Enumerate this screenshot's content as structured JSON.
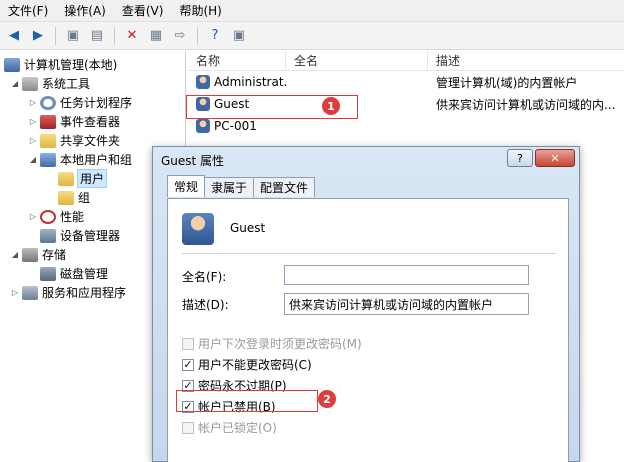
{
  "menubar": {
    "items": [
      "文件(F)",
      "操作(A)",
      "查看(V)",
      "帮助(H)"
    ]
  },
  "toolbar": {
    "buttons": [
      "back-arrow-icon",
      "forward-arrow-icon",
      "up-folder-icon",
      "show-hide-tree-icon",
      "delete-icon",
      "properties-icon",
      "export-icon",
      "help-icon",
      "panel-icon"
    ]
  },
  "tree": {
    "items": [
      {
        "label": "计算机管理(本地)",
        "icon": "computer-icon"
      },
      {
        "label": "系统工具",
        "icon": "tools-icon"
      },
      {
        "label": "任务计划程序",
        "icon": "clock-icon"
      },
      {
        "label": "事件查看器",
        "icon": "event-viewer-icon"
      },
      {
        "label": "共享文件夹",
        "icon": "shared-folder-icon"
      },
      {
        "label": "本地用户和组",
        "icon": "users-group-icon"
      },
      {
        "label": "用户",
        "icon": "folder-icon"
      },
      {
        "label": "组",
        "icon": "folder-icon"
      },
      {
        "label": "性能",
        "icon": "performance-icon"
      },
      {
        "label": "设备管理器",
        "icon": "device-manager-icon"
      },
      {
        "label": "存储",
        "icon": "storage-icon"
      },
      {
        "label": "磁盘管理",
        "icon": "disk-icon"
      },
      {
        "label": "服务和应用程序",
        "icon": "services-icon"
      }
    ]
  },
  "list": {
    "headers": [
      "名称",
      "全名",
      "描述"
    ],
    "rows": [
      {
        "name": "Administrat...",
        "fullname": "",
        "desc": "管理计算机(域)的内置帐户"
      },
      {
        "name": "Guest",
        "fullname": "",
        "desc": "供来宾访问计算机或访问域的内..."
      },
      {
        "name": "PC-001",
        "fullname": "",
        "desc": ""
      }
    ]
  },
  "callouts": {
    "one": "1",
    "two": "2"
  },
  "dialog": {
    "title": "Guest 属性",
    "help_button": "?",
    "close_button": "✕",
    "tabs": [
      "常规",
      "隶属于",
      "配置文件"
    ],
    "username": "Guest",
    "fullname_label": "全名(F):",
    "fullname_value": "",
    "desc_label": "描述(D):",
    "desc_value": "供来宾访问计算机或访问域的内置帐户",
    "checks": [
      {
        "label": "用户下次登录时须更改密码(M)",
        "checked": false,
        "disabled": true
      },
      {
        "label": "用户不能更改密码(C)",
        "checked": true,
        "disabled": false
      },
      {
        "label": "密码永不过期(P)",
        "checked": true,
        "disabled": false
      },
      {
        "label": "帐户已禁用(B)",
        "checked": true,
        "disabled": false
      },
      {
        "label": "帐户已锁定(O)",
        "checked": false,
        "disabled": true
      }
    ]
  }
}
